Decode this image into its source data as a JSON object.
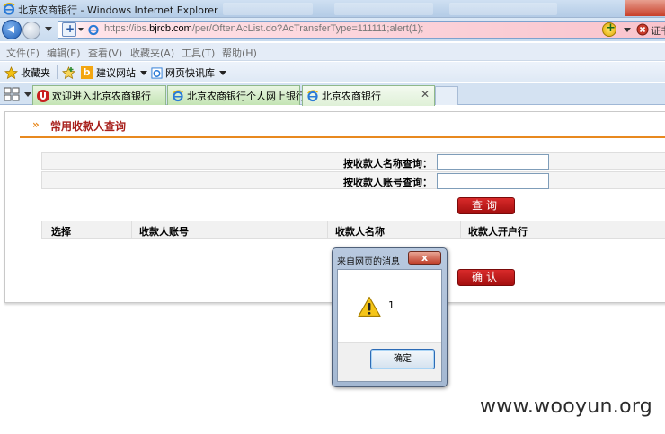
{
  "window": {
    "title": "北京农商银行 - Windows Internet Explorer"
  },
  "addressbar": {
    "url_prefix": "https://ibs.",
    "url_domain": "bjrcb.com",
    "url_path": "/per/OftenAcList.do?AcTransferType=111111;alert(1);",
    "cert_label": "证书"
  },
  "menu": {
    "items": [
      "文件(F)",
      "编辑(E)",
      "查看(V)",
      "收藏夹(A)",
      "工具(T)",
      "帮助(H)"
    ]
  },
  "favorites_bar": {
    "favorites_label": "收藏夹",
    "suggested_sites": "建议网站",
    "web_slice": "网页快讯库"
  },
  "tabs": [
    {
      "label": "欢迎进入北京农商银行",
      "active": false
    },
    {
      "label": "北京农商银行个人网上银行",
      "active": false
    },
    {
      "label": "北京农商银行",
      "active": true
    }
  ],
  "page": {
    "section_title": "常用收款人查询",
    "section_arrows": "»",
    "query_name_label": "按收款人名称查询：",
    "query_account_label": "按收款人账号查询：",
    "query_name_value": "",
    "query_account_value": "",
    "search_button": "查询",
    "confirm_button": "确认",
    "table_headers": [
      "选择",
      "收款人账号",
      "收款人名称",
      "收款人开户行"
    ]
  },
  "dialog": {
    "title": "来自网页的消息",
    "close_glyph": "x",
    "message": "1",
    "ok_button": "确定"
  },
  "watermark": "www.wooyun.org"
}
